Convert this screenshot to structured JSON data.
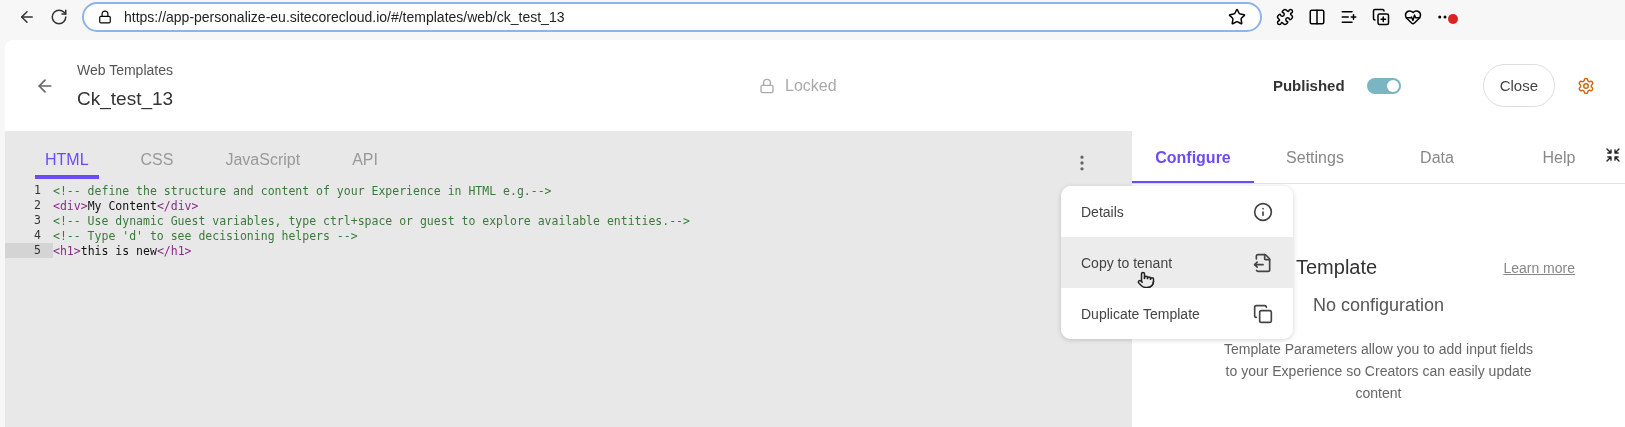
{
  "browser": {
    "url": "https://app-personalize-eu.sitecorecloud.io/#/templates/web/ck_test_13"
  },
  "header": {
    "breadcrumb": "Web Templates",
    "title": "Ck_test_13",
    "lock_status": "Locked",
    "published_label": "Published",
    "published_on": true,
    "close_button": "Close"
  },
  "editor": {
    "tabs": [
      {
        "label": "HTML",
        "selected": true
      },
      {
        "label": "CSS",
        "selected": false
      },
      {
        "label": "JavaScript",
        "selected": false
      },
      {
        "label": "API",
        "selected": false
      }
    ],
    "lines": [
      {
        "number": "1",
        "active": false,
        "tokens": [
          {
            "kind": "comment",
            "text": "<!-- define the structure and content of your Experience in HTML e.g.-->"
          }
        ]
      },
      {
        "number": "2",
        "active": false,
        "tokens": [
          {
            "kind": "tag",
            "text": "<div>"
          },
          {
            "kind": "text",
            "text": "My Content"
          },
          {
            "kind": "tag",
            "text": "</div>"
          }
        ]
      },
      {
        "number": "3",
        "active": false,
        "tokens": [
          {
            "kind": "comment",
            "text": "<!-- Use dynamic Guest variables, type ctrl+space or guest to explore available entities.-->"
          }
        ]
      },
      {
        "number": "4",
        "active": false,
        "tokens": [
          {
            "kind": "comment",
            "text": "<!-- Type 'd' to see decisioning helpers -->"
          }
        ]
      },
      {
        "number": "5",
        "active": true,
        "tokens": [
          {
            "kind": "tag",
            "text": "<h1>"
          },
          {
            "kind": "text",
            "text": "this is new"
          },
          {
            "kind": "tag",
            "text": "</h1>"
          }
        ]
      }
    ]
  },
  "menu": {
    "items": [
      {
        "label": "Details",
        "hovered": false
      },
      {
        "label": "Copy to tenant",
        "hovered": true
      },
      {
        "label": "Duplicate Template",
        "hovered": false
      }
    ]
  },
  "panel": {
    "tabs": [
      {
        "label": "Configure",
        "selected": true
      },
      {
        "label": "Settings",
        "selected": false
      },
      {
        "label": "Data",
        "selected": false
      },
      {
        "label": "Help",
        "selected": false
      }
    ],
    "heading": "Template",
    "learn_more": "Learn more",
    "empty_title": "No configuration",
    "empty_text": "Template Parameters allow you to add input fields to your Experience so Creators can easily update content"
  }
}
